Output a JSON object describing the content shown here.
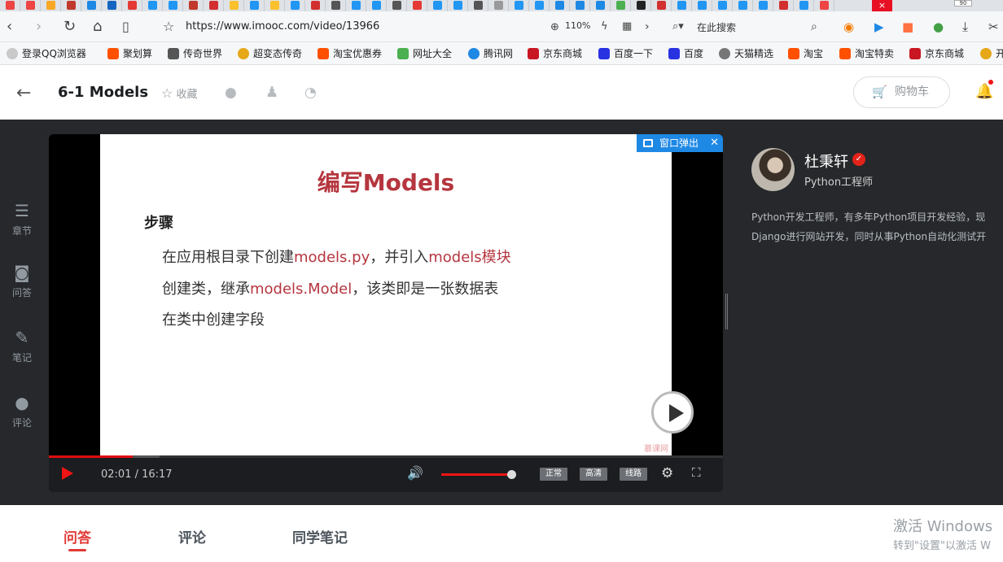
{
  "browser": {
    "tab_strip": {
      "close_glyph": "×",
      "counter": "90"
    },
    "url": "https://www.imooc.com/video/13966",
    "zoom": "110%",
    "search_placeholder": "在此搜索",
    "bookmarks": [
      {
        "label": "登录QQ浏览器",
        "color": "#c9c9c9"
      },
      {
        "label": "聚划算",
        "color": "#ff5000"
      },
      {
        "label": "传奇世界",
        "color": "#555555"
      },
      {
        "label": "超变态传奇",
        "color": "#e6a817"
      },
      {
        "label": "淘宝优惠券",
        "color": "#ff5000"
      },
      {
        "label": "网址大全",
        "color": "#4caf50"
      },
      {
        "label": "腾讯网",
        "color": "#1e88e5"
      },
      {
        "label": "京东商城",
        "color": "#c91623"
      },
      {
        "label": "百度一下",
        "color": "#2932e1"
      },
      {
        "label": "百度",
        "color": "#2932e1"
      },
      {
        "label": "天猫精选",
        "color": "#777777"
      },
      {
        "label": "淘宝",
        "color": "#ff5000"
      },
      {
        "label": "淘宝特卖",
        "color": "#ff5000"
      },
      {
        "label": "京东商城",
        "color": "#c91623"
      },
      {
        "label": "开",
        "color": "#e6a817"
      }
    ]
  },
  "header": {
    "title": "6-1 Models",
    "collect_label": "收藏",
    "cart_label": "购物车"
  },
  "sidebar": {
    "items": [
      {
        "label": "章节"
      },
      {
        "label": "问答"
      },
      {
        "label": "笔记"
      },
      {
        "label": "评论"
      }
    ]
  },
  "player": {
    "popout_label": "窗口弹出",
    "slide": {
      "title": "编写Models",
      "step_label": "步骤",
      "line1_a": "在应用根目录下创建",
      "line1_b": "models.py",
      "line1_c": "，并引入",
      "line1_d": "models模块",
      "line2_a": "创建类，继承",
      "line2_b": "models.Model",
      "line2_c": "，该类即是一张数据表",
      "line3": "在类中创建字段",
      "watermark": "慕课网"
    },
    "time_display": "02:01 / 16:17",
    "progress_fraction": 0.124,
    "volume_fraction": 1.0,
    "quality_buttons": [
      "正常",
      "高清",
      "线路"
    ]
  },
  "teacher": {
    "name": "杜秉轩",
    "role": "Python工程师",
    "desc_line1": "Python开发工程师，有多年Python项目开发经验，现",
    "desc_line2": "Django进行网站开发，同时从事Python自动化测试开"
  },
  "tabs": [
    "问答",
    "评论",
    "同学笔记"
  ],
  "os_watermark": {
    "line1": "激活 Windows",
    "line2": "转到\"设置\"以激活 W"
  },
  "colors": {
    "accent": "#e13a35",
    "popout": "#1e88e5"
  }
}
